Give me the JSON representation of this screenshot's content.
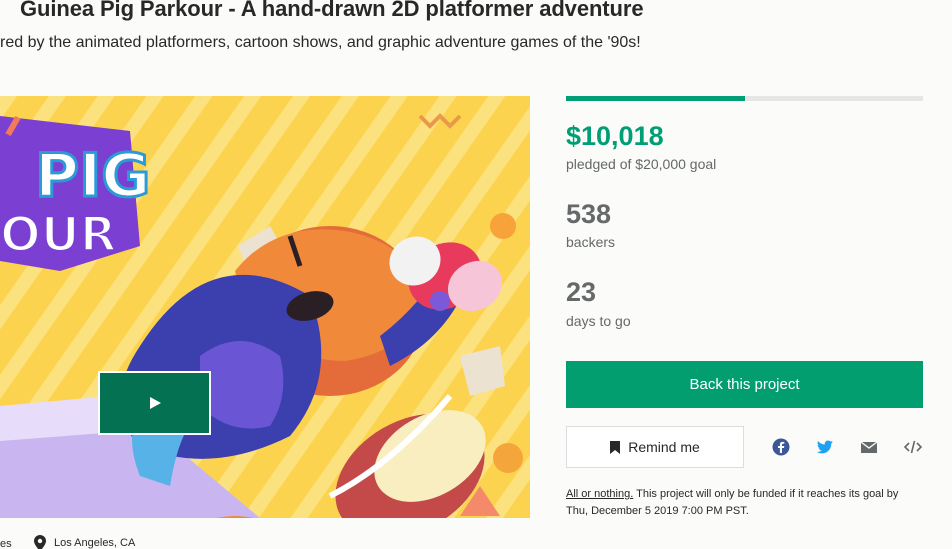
{
  "project": {
    "title": "Guinea Pig Parkour - A hand-drawn 2D platformer adventure",
    "subtitle": "red by the animated platformers, cartoon shows, and graphic adventure games of the '90s!"
  },
  "hero": {
    "logo_top": "PIG",
    "logo_bottom": "OUR",
    "play_icon": "play-icon"
  },
  "meta": {
    "category_fragment": "es",
    "location": "Los Angeles, CA",
    "location_icon": "map-pin-icon"
  },
  "funding": {
    "progress_fraction": 0.5009,
    "pledged": "$10,018",
    "pledged_label": "pledged of $20,000 goal",
    "backers": "538",
    "backers_label": "backers",
    "days": "23",
    "days_label": "days to go"
  },
  "actions": {
    "back_label": "Back this project",
    "remind_label": "Remind me",
    "remind_icon": "bookmark-icon",
    "share_icons": [
      "facebook-icon",
      "twitter-icon",
      "email-icon",
      "embed-icon"
    ]
  },
  "colors": {
    "accent": "#009e74",
    "button": "#039e70",
    "play_button": "#047153",
    "facebook": "#3b5998",
    "twitter": "#1da1f2"
  },
  "notice": {
    "link": "All or nothing.",
    "text": " This project will only be funded if it reaches its goal by Thu, December 5 2019 7:00 PM PST."
  }
}
